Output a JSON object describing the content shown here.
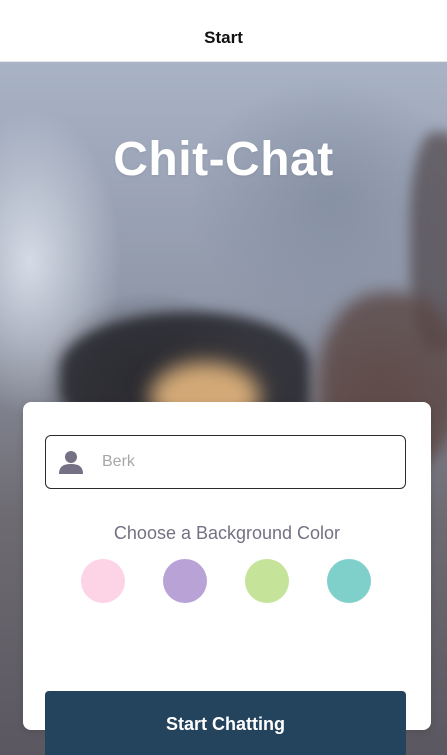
{
  "nav": {
    "title": "Start"
  },
  "hero": {
    "app_title": "Chit-Chat"
  },
  "form": {
    "name_placeholder": "Berk",
    "name_value": "",
    "user_icon": "user-icon",
    "color_prompt": "Choose a Background Color",
    "colors": [
      {
        "name": "pink",
        "hex": "#fdd3e6"
      },
      {
        "name": "purple",
        "hex": "#b9a3d6"
      },
      {
        "name": "green",
        "hex": "#c6e39a"
      },
      {
        "name": "teal",
        "hex": "#7fcfcb"
      }
    ],
    "start_label": "Start Chatting"
  },
  "theme": {
    "button_color": "#24435d",
    "label_color": "#757083"
  }
}
